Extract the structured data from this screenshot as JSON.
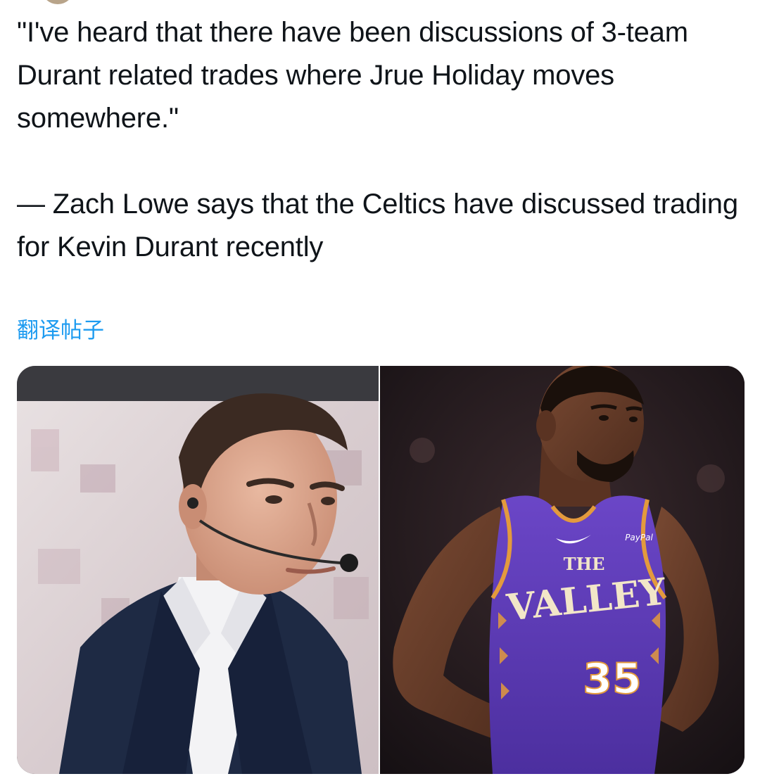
{
  "tweet": {
    "quote": "\"I've heard that there have been discussions of 3-team Durant related trades where Jrue Holiday moves somewhere.\"",
    "attribution": "— Zach Lowe says that the Celtics have discussed trading for Kevin Durant recently",
    "translate_label": "翻译帖子"
  },
  "media": {
    "jersey": {
      "top": "THE",
      "main": "VALLEY",
      "number": "35",
      "sponsor": "PayPal"
    }
  },
  "colors": {
    "link": "#1d9bf0",
    "text": "#0f1419",
    "jersey_purple": "#5b3bb0"
  }
}
